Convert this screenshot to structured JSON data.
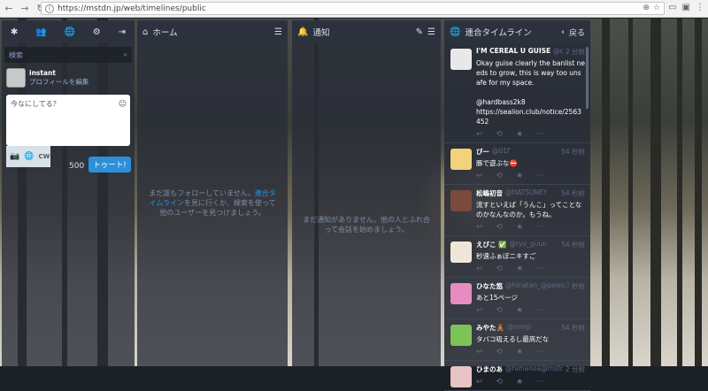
{
  "browser": {
    "url": "https://mstdn.jp/web/timelines/public"
  },
  "compose_column": {
    "search_placeholder": "検索",
    "display_name": "instant",
    "edit_profile": "プロフィールを編集",
    "compose_placeholder": "今なにしてる？",
    "cw_label": "CW",
    "char_count": "500",
    "toot_button": "トゥート!"
  },
  "home_column": {
    "title": "ホーム",
    "empty_text_1": "まだ誰もフォローしていません。",
    "empty_link": "連合タイムライン",
    "empty_text_2": "を見に行くか、検索を使って他のユーザーを見つけましょう。"
  },
  "notif_column": {
    "title": "通知",
    "empty_text": "まだ通知がありません。他の人とふれ合って会話を始めましょう。"
  },
  "fed_column": {
    "title": "連合タイムライン",
    "back": "戻る",
    "statuses": [
      {
        "name": "I'M CEREAL U GUISE",
        "acct": "@cere",
        "time": "2 分前",
        "text": "Okay guise clearly the banlist needs to grow, this is way too unsafe for my space.\n\n@hardbass2k8\nhttps://sealion.club/notice/2563452",
        "color": "#e8e8e8"
      },
      {
        "name": "びー",
        "acct": "@01f",
        "time": "54 秒前",
        "text": "豚で遊ぶな⛔",
        "color": "#f2d27a"
      },
      {
        "name": "松嶋初音",
        "acct": "@HATSUNEY",
        "time": "54 秒前",
        "text": "流すといえば「うんこ」ってことなのかなんなのか。もうね。",
        "color": "#7a4a3a"
      },
      {
        "name": "えびこ ✅",
        "acct": "@ryo_guun",
        "time": "54 秒前",
        "text": "秒速ふぁぼニキすご",
        "color": "#f0e6d8"
      },
      {
        "name": "ひなた悠",
        "acct": "@hinatan_@pawo.55",
        "time": "秒前",
        "text": "あと15ページ",
        "color": "#e88cc0"
      },
      {
        "name": "みやた🧸",
        "acct": "@romp",
        "time": "54 秒前",
        "text": "タバコ吸えるし最高だな",
        "color": "#7cc456"
      },
      {
        "name": "ひまのあ",
        "acct": "@himanoa@mstdn.",
        "time": "2 分前",
        "text": "",
        "color": "#e8c4c4"
      }
    ]
  }
}
